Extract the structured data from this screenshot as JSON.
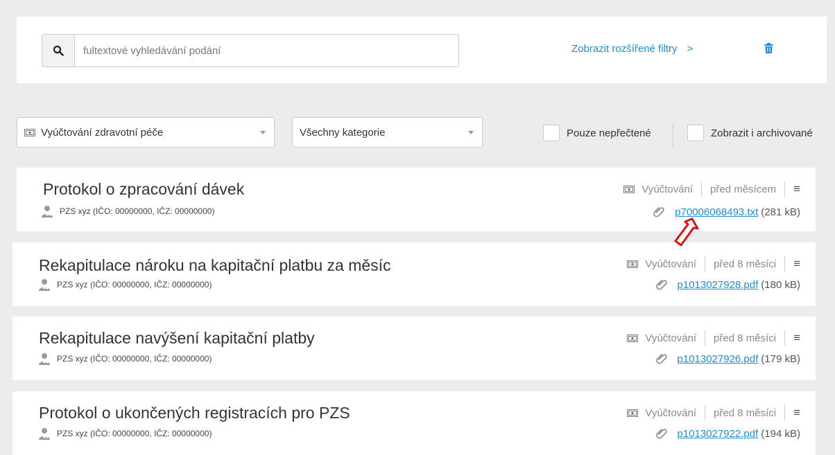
{
  "search": {
    "placeholder": "fultextové vyhledávání podání",
    "advanced_filters_label": "Zobrazit rozšířené filtry",
    "advanced_filters_chevron": ">"
  },
  "filters": {
    "agenda_select": "Vyúčtování zdravotní péče",
    "category_select": "Všechny kategorie",
    "unread_only_label": "Pouze nepřečtené",
    "show_archived_label": "Zobrazit i archivované"
  },
  "messages": [
    {
      "title": "Protokol o zpracování dávek",
      "sender": "PZS xyz (IČO: 00000000, IČZ: 00000000)",
      "category": "Vyúčtování",
      "time": "před měsícem",
      "file_name": "p70006068493.txt",
      "file_size": "(281 kB)"
    },
    {
      "title": "Rekapitulace nároku na kapitační platbu za měsíc",
      "sender": "PZS xyz (IČO: 00000000, IČZ: 00000000)",
      "category": "Vyúčtování",
      "time": "před 8 měsíci",
      "file_name": "p1013027928.pdf",
      "file_size": "(180 kB)"
    },
    {
      "title": "Rekapitulace navýšení kapitační platby",
      "sender": "PZS xyz (IČO: 00000000, IČZ: 00000000)",
      "category": "Vyúčtování",
      "time": "před 8 měsíci",
      "file_name": "p1013027926.pdf",
      "file_size": "(179 kB)"
    },
    {
      "title": "Protokol o ukončených registracích pro PZS",
      "sender": "PZS xyz (IČO: 00000000, IČZ: 00000000)",
      "category": "Vyúčtování",
      "time": "před 8 měsíci",
      "file_name": "p1013027922.pdf",
      "file_size": "(194 kB)"
    }
  ],
  "icons": {
    "search": "search-icon",
    "trash": "trash-icon",
    "money": "money-icon",
    "person": "doctor-icon",
    "menu": "hamburger-icon",
    "attachment": "paperclip-icon",
    "annotation": "red-arrow-icon"
  },
  "colors": {
    "link": "#1a8fd6",
    "annotation_arrow": "#e01010",
    "background": "#ececec"
  }
}
